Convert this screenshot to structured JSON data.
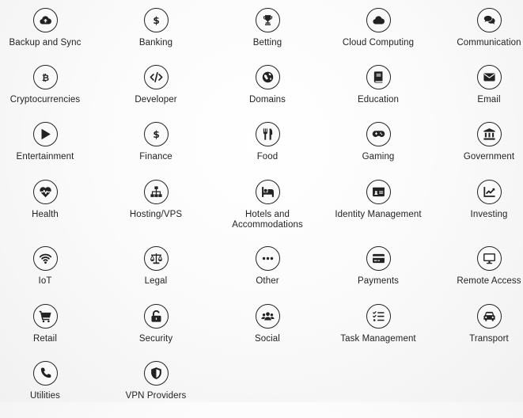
{
  "categories": [
    {
      "label": "Backup and Sync",
      "icon": "cloud-upload-icon"
    },
    {
      "label": "Banking",
      "icon": "dollar-icon"
    },
    {
      "label": "Betting",
      "icon": "trophy-icon"
    },
    {
      "label": "Cloud Computing",
      "icon": "cloud-icon"
    },
    {
      "label": "Communication",
      "icon": "chat-icon"
    },
    {
      "label": "Cryptocurrencies",
      "icon": "bitcoin-icon"
    },
    {
      "label": "Developer",
      "icon": "code-icon"
    },
    {
      "label": "Domains",
      "icon": "globe-icon"
    },
    {
      "label": "Education",
      "icon": "book-icon"
    },
    {
      "label": "Email",
      "icon": "envelope-icon"
    },
    {
      "label": "Entertainment",
      "icon": "play-icon"
    },
    {
      "label": "Finance",
      "icon": "dollar-icon"
    },
    {
      "label": "Food",
      "icon": "utensils-icon"
    },
    {
      "label": "Gaming",
      "icon": "gamepad-icon"
    },
    {
      "label": "Government",
      "icon": "landmark-icon"
    },
    {
      "label": "Health",
      "icon": "heartbeat-icon"
    },
    {
      "label": "Hosting/VPS",
      "icon": "sitemap-icon"
    },
    {
      "label": "Hotels and\nAccommodations",
      "icon": "bed-icon"
    },
    {
      "label": "Identity Management",
      "icon": "id-card-icon"
    },
    {
      "label": "Investing",
      "icon": "chart-line-icon"
    },
    {
      "label": "IoT",
      "icon": "wifi-icon"
    },
    {
      "label": "Legal",
      "icon": "scale-icon"
    },
    {
      "label": "Other",
      "icon": "ellipsis-icon"
    },
    {
      "label": "Payments",
      "icon": "credit-card-icon"
    },
    {
      "label": "Remote Access",
      "icon": "desktop-icon"
    },
    {
      "label": "Retail",
      "icon": "cart-icon"
    },
    {
      "label": "Security",
      "icon": "unlock-icon"
    },
    {
      "label": "Social",
      "icon": "users-icon"
    },
    {
      "label": "Task Management",
      "icon": "tasks-icon"
    },
    {
      "label": "Transport",
      "icon": "car-icon"
    },
    {
      "label": "Utilities",
      "icon": "phone-icon"
    },
    {
      "label": "VPN Providers",
      "icon": "shield-icon"
    }
  ]
}
